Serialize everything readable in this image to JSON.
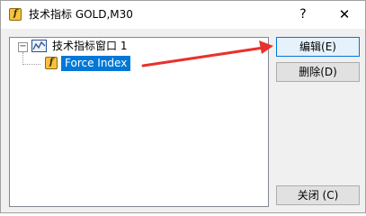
{
  "window": {
    "title": "技术指标 GOLD,M30",
    "help_glyph": "?",
    "close_glyph": "✕"
  },
  "tree": {
    "expander_glyph": "⊟",
    "root_label": "技术指标窗口 1",
    "child_label": "Force Index",
    "indicator_icon_glyph": "f"
  },
  "buttons": {
    "edit_label": "编辑(E)",
    "delete_label": "删除(D)",
    "close_label": "关闭 (C)"
  },
  "colors": {
    "selection": "#0078d7",
    "annotation_arrow": "#e8322d",
    "indicator_icon": "#f6c23e"
  },
  "icons": {
    "title": "indicator-f-icon",
    "window": "chart-window-icon",
    "indicator": "indicator-f-icon"
  }
}
